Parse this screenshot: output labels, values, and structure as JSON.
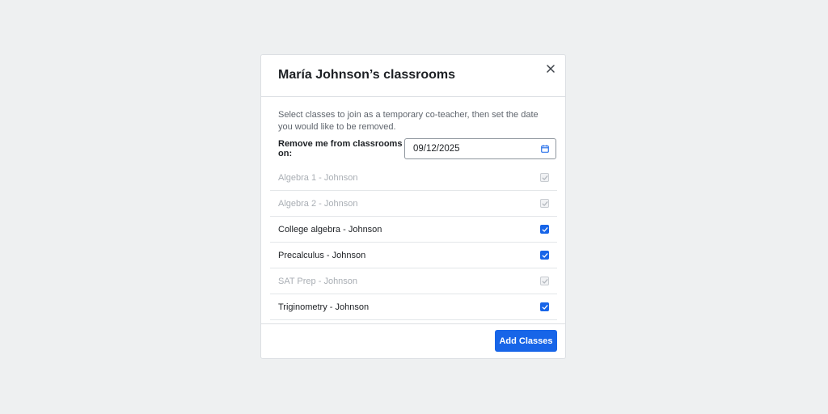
{
  "modal": {
    "title": "María Johnson’s classrooms",
    "close_icon": "close-icon",
    "description": "Select classes to join as a temporary co-teacher, then set the date you would like to be removed.",
    "date_label": "Remove me from classrooms on:",
    "date_value": "09/12/2025",
    "date_icon": "calendar-icon",
    "classes": [
      {
        "name": "Algebra 1 - Johnson",
        "checked": true,
        "disabled": true
      },
      {
        "name": "Algebra 2 - Johnson",
        "checked": true,
        "disabled": true
      },
      {
        "name": "College algebra - Johnson",
        "checked": true,
        "disabled": false
      },
      {
        "name": "Precalculus - Johnson",
        "checked": true,
        "disabled": false
      },
      {
        "name": "SAT Prep - Johnson",
        "checked": true,
        "disabled": true
      },
      {
        "name": "Triginometry - Johnson",
        "checked": true,
        "disabled": false
      }
    ],
    "submit_label": "Add Classes"
  },
  "colors": {
    "background": "#eef0f1",
    "accent": "#1765e8",
    "text": "#1d2024",
    "muted_text": "#a9aeb4",
    "border": "#dcdfe3"
  }
}
